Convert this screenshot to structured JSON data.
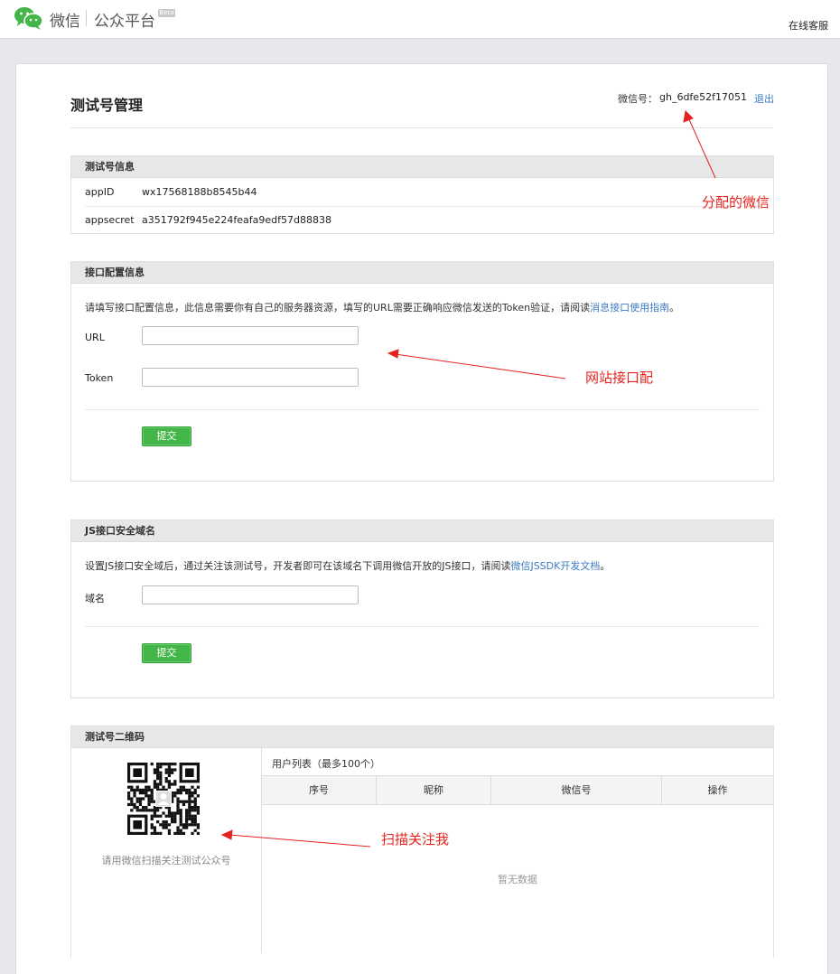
{
  "header": {
    "brand": "微信",
    "platform": "公众平台",
    "beta": "Beta",
    "support_link": "在线客服"
  },
  "page": {
    "title": "测试号管理",
    "account_label": "微信号：",
    "account_value": "gh_6dfe52f17051",
    "logout": "退出"
  },
  "test_account_info": {
    "heading": "测试号信息",
    "appid_label": "appID",
    "appid_value": "wx17568188b8545b44",
    "appsecret_label": "appsecret",
    "appsecret_value": "a351792f945e224feafa9edf57d88838"
  },
  "interface_config": {
    "heading": "接口配置信息",
    "desc_prefix": "请填写接口配置信息，此信息需要你有自己的服务器资源，填写的URL需要正确响应微信发送的Token验证，请阅读",
    "desc_link": "消息接口使用指南",
    "desc_suffix": "。",
    "url_label": "URL",
    "url_value": "",
    "token_label": "Token",
    "token_value": "",
    "submit": "提交"
  },
  "js_domain": {
    "heading": "JS接口安全域名",
    "desc_prefix": "设置JS接口安全域后，通过关注该测试号，开发者即可在该域名下调用微信开放的JS接口，请阅读",
    "desc_link": "微信JSSDK开发文档",
    "desc_suffix": "。",
    "domain_label": "域名",
    "domain_value": "",
    "submit": "提交"
  },
  "qrcode": {
    "heading": "测试号二维码",
    "caption": "请用微信扫描关注测试公众号",
    "user_list_title": "用户列表（最多100个）",
    "columns": [
      "序号",
      "昵称",
      "微信号",
      "操作"
    ],
    "empty": "暂无数据"
  },
  "annotations": {
    "wechat_id": "分配的微信",
    "site_interface": "网站接口配",
    "scan_follow": "扫描关注我"
  },
  "colors": {
    "accent_green": "#44b549",
    "link_blue": "#3d7bc6",
    "annotation_red": "#e5221c"
  }
}
